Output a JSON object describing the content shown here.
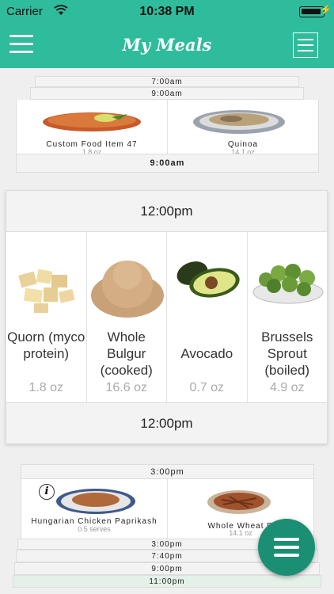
{
  "status_bar": {
    "carrier": "Carrier",
    "time": "10:38 PM"
  },
  "navbar": {
    "title": "My Meals"
  },
  "group1": {
    "layers": [
      "7:00am",
      "9:00am"
    ],
    "items": [
      {
        "name": "Custom Food Item 47",
        "qty": "1.8 oz"
      },
      {
        "name": "Quinoa",
        "qty": "14.1 oz"
      }
    ],
    "footer": "9:00am"
  },
  "group2": {
    "header": "12:00pm",
    "items": [
      {
        "name": "Quorn (myco protein)",
        "qty": "1.8 oz"
      },
      {
        "name": "Whole Bulgur (cooked)",
        "qty": "16.6 oz"
      },
      {
        "name": "Avocado",
        "qty": "0.7 oz"
      },
      {
        "name": "Brussels Sprout (boiled)",
        "qty": "4.9 oz"
      }
    ],
    "footer": "12:00pm"
  },
  "group3": {
    "header": "3:00pm",
    "items": [
      {
        "name": "Hungarian Chicken Paprikash",
        "qty": "0.5 serves"
      },
      {
        "name": "Whole Wheat R",
        "qty": "14.1 oz"
      }
    ],
    "layers": [
      "3:00pm",
      "7:40pm",
      "9:00pm",
      "11:00pm"
    ]
  }
}
